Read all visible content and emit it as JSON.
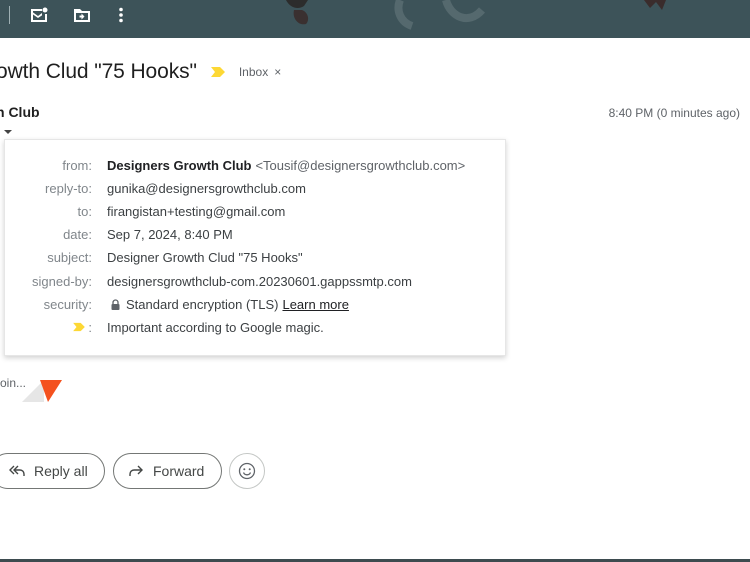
{
  "toolbar": {
    "icons": [
      "mark-unread-icon",
      "move-to-icon",
      "more-vert-icon"
    ]
  },
  "subject": {
    "text": "owth Clud \"75 Hooks\"",
    "label_chip": "Inbox",
    "label_chip_close": "×"
  },
  "sender": {
    "name": "n Club",
    "time": "8:40 PM (0 minutes ago)"
  },
  "behind_text": {
    "snippet": "oin..."
  },
  "details": {
    "from_label": "from:",
    "from_name": "Designers Growth Club",
    "from_email": "<Tousif@designersgrowthclub.com>",
    "reply_to_label": "reply-to:",
    "reply_to": "gunika@designersgrowthclub.com",
    "to_label": "to:",
    "to": "firangistan+testing@gmail.com",
    "date_label": "date:",
    "date": "Sep 7, 2024, 8:40 PM",
    "subject_label": "subject:",
    "subject": "Designer Growth Clud \"75 Hooks\"",
    "signed_by_label": "signed-by:",
    "signed_by": "designersgrowthclub-com.20230601.gappssmtp.com",
    "security_label": "security:",
    "security": "Standard encryption (TLS)",
    "learn_more": "Learn more",
    "importance_label": ":",
    "importance": "Important according to Google magic."
  },
  "actions": {
    "reply_all": "Reply all",
    "forward": "Forward"
  },
  "colors": {
    "topbar": "#3d5359",
    "importance_marker": "#fdd835",
    "thumb_accent": "#f4511e"
  }
}
